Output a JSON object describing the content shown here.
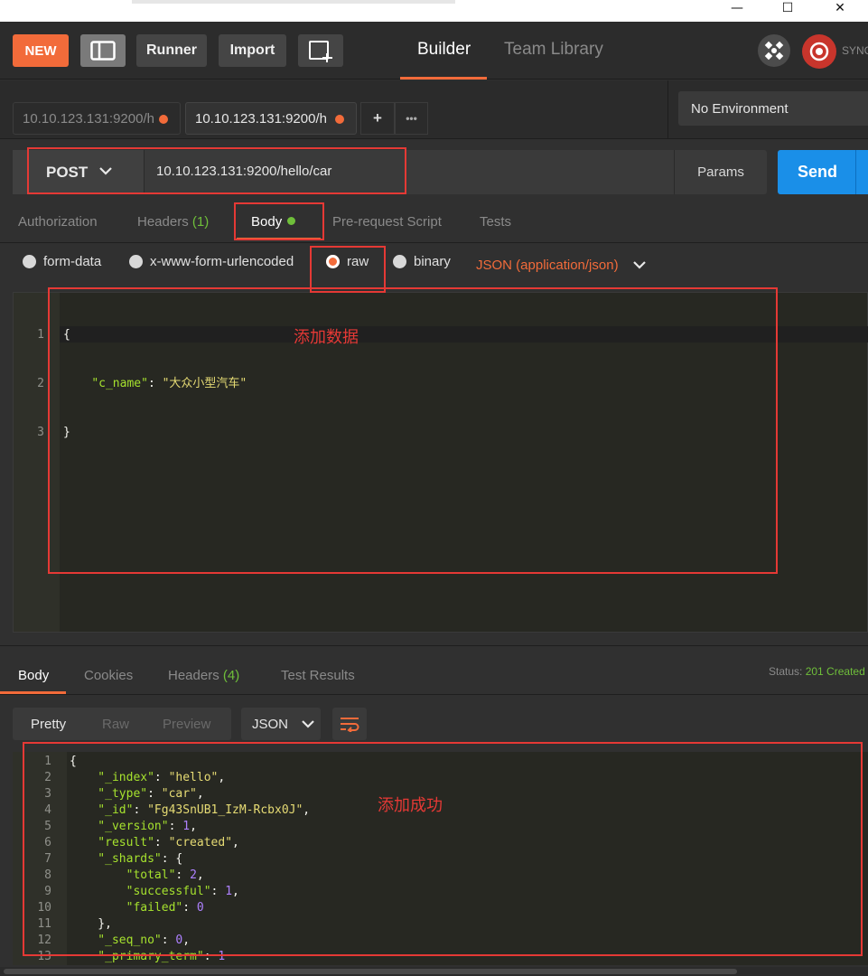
{
  "window": {
    "minimize": "—",
    "maximize": "☐",
    "close": "✕"
  },
  "header": {
    "new_label": "NEW",
    "runner_label": "Runner",
    "import_label": "Import",
    "nav_builder": "Builder",
    "nav_team_library": "Team Library",
    "sync_label": "SYNC"
  },
  "tabs": {
    "items": [
      {
        "label": "10.10.123.131:9200/h",
        "active": false
      },
      {
        "label": "10.10.123.131:9200/h",
        "active": true
      }
    ],
    "add_label": "+",
    "more_label": "•••",
    "environment": "No Environment"
  },
  "request": {
    "method": "POST",
    "url": "10.10.123.131:9200/hello/car",
    "params_label": "Params",
    "send_label": "Send"
  },
  "request_tabs": {
    "authorization": "Authorization",
    "headers": "Headers",
    "headers_count": "(1)",
    "body": "Body",
    "prerequest": "Pre-request Script",
    "tests": "Tests"
  },
  "body_types": {
    "form_data": "form-data",
    "urlencoded": "x-www-form-urlencoded",
    "raw": "raw",
    "binary": "binary",
    "selected": "raw",
    "content_type": "JSON (application/json)"
  },
  "request_body": {
    "line_numbers": [
      "1",
      "2",
      "3"
    ],
    "line1": "{",
    "line2_key": "\"c_name\"",
    "line2_sep": ": ",
    "line2_val": "\"大众小型汽车\"",
    "line3": "}"
  },
  "annotations": {
    "add_data": "添加数据",
    "add_success": "添加成功"
  },
  "response": {
    "tabs": {
      "body": "Body",
      "cookies": "Cookies",
      "headers": "Headers",
      "headers_count": "(4)",
      "test_results": "Test Results"
    },
    "status_label": "Status:",
    "status_value": "201 Created",
    "view": {
      "pretty": "Pretty",
      "raw": "Raw",
      "preview": "Preview"
    },
    "format": "JSON",
    "line_numbers": [
      "1",
      "2",
      "3",
      "4",
      "5",
      "6",
      "7",
      "8",
      "9",
      "10",
      "11",
      "12",
      "13"
    ],
    "lines": [
      [
        [
          "p",
          "{"
        ]
      ],
      [
        [
          "k",
          "    \"_index\""
        ],
        [
          "p",
          ": "
        ],
        [
          "s",
          "\"hello\""
        ],
        [
          "p",
          ","
        ]
      ],
      [
        [
          "k",
          "    \"_type\""
        ],
        [
          "p",
          ": "
        ],
        [
          "s",
          "\"car\""
        ],
        [
          "p",
          ","
        ]
      ],
      [
        [
          "k",
          "    \"_id\""
        ],
        [
          "p",
          ": "
        ],
        [
          "s",
          "\"Fg43SnUB1_IzM-Rcbx0J\""
        ],
        [
          "p",
          ","
        ]
      ],
      [
        [
          "k",
          "    \"_version\""
        ],
        [
          "p",
          ": "
        ],
        [
          "n",
          "1"
        ],
        [
          "p",
          ","
        ]
      ],
      [
        [
          "k",
          "    \"result\""
        ],
        [
          "p",
          ": "
        ],
        [
          "s",
          "\"created\""
        ],
        [
          "p",
          ","
        ]
      ],
      [
        [
          "k",
          "    \"_shards\""
        ],
        [
          "p",
          ": {"
        ]
      ],
      [
        [
          "k",
          "        \"total\""
        ],
        [
          "p",
          ": "
        ],
        [
          "n",
          "2"
        ],
        [
          "p",
          ","
        ]
      ],
      [
        [
          "k",
          "        \"successful\""
        ],
        [
          "p",
          ": "
        ],
        [
          "n",
          "1"
        ],
        [
          "p",
          ","
        ]
      ],
      [
        [
          "k",
          "        \"failed\""
        ],
        [
          "p",
          ": "
        ],
        [
          "n",
          "0"
        ]
      ],
      [
        [
          "p",
          "    },"
        ]
      ],
      [
        [
          "k",
          "    \"_seq_no\""
        ],
        [
          "p",
          ": "
        ],
        [
          "n",
          "0"
        ],
        [
          "p",
          ","
        ]
      ],
      [
        [
          "k",
          "    \"_primary_term\""
        ],
        [
          "p",
          ": "
        ],
        [
          "n",
          "1"
        ]
      ]
    ]
  },
  "colors": {
    "accent": "#f26b3a",
    "send": "#1a8fe8",
    "status_ok": "#6fbf3a",
    "annotation": "#e53935"
  }
}
